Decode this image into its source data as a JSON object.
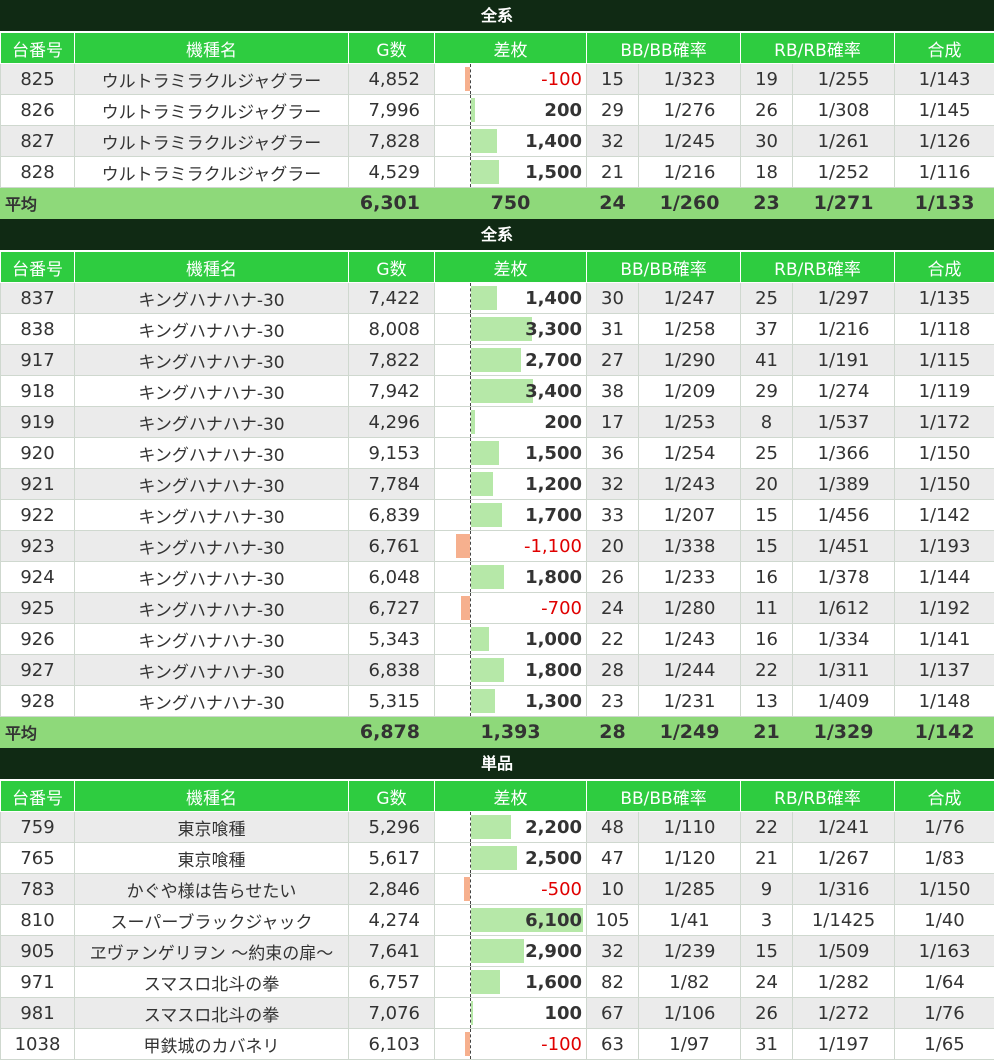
{
  "headers": {
    "no": "台番号",
    "name": "機種名",
    "g": "G数",
    "diff": "差枚",
    "bb": "BB/BB確率",
    "rb": "RB/RB確率",
    "total": "合成"
  },
  "colors": {
    "title_bg": "#102a14",
    "header_bg": "#2ecc40",
    "avg_bg": "#8ed97a",
    "pos_bar": "#b6e8a8",
    "neg_bar": "#f6b08e",
    "neg_text": "#e00000"
  },
  "sections": [
    {
      "title": "全系",
      "rows": [
        {
          "no": "825",
          "name": "ウルトラミラクルジャグラー",
          "g": "4,852",
          "diff": "-100",
          "diff_value": -100,
          "bb": "15",
          "bb_prob": "1/323",
          "rb": "19",
          "rb_prob": "1/255",
          "total": "1/143"
        },
        {
          "no": "826",
          "name": "ウルトラミラクルジャグラー",
          "g": "7,996",
          "diff": "200",
          "diff_value": 200,
          "bb": "29",
          "bb_prob": "1/276",
          "rb": "26",
          "rb_prob": "1/308",
          "total": "1/145"
        },
        {
          "no": "827",
          "name": "ウルトラミラクルジャグラー",
          "g": "7,828",
          "diff": "1,400",
          "diff_value": 1400,
          "bb": "32",
          "bb_prob": "1/245",
          "rb": "30",
          "rb_prob": "1/261",
          "total": "1/126"
        },
        {
          "no": "828",
          "name": "ウルトラミラクルジャグラー",
          "g": "4,529",
          "diff": "1,500",
          "diff_value": 1500,
          "bb": "21",
          "bb_prob": "1/216",
          "rb": "18",
          "rb_prob": "1/252",
          "total": "1/116"
        }
      ],
      "avg": {
        "label": "平均",
        "g": "6,301",
        "diff": "750",
        "bb": "24",
        "bb_prob": "1/260",
        "rb": "23",
        "rb_prob": "1/271",
        "total": "1/133"
      }
    },
    {
      "title": "全系",
      "rows": [
        {
          "no": "837",
          "name": "キングハナハナ-30",
          "g": "7,422",
          "diff": "1,400",
          "diff_value": 1400,
          "bb": "30",
          "bb_prob": "1/247",
          "rb": "25",
          "rb_prob": "1/297",
          "total": "1/135"
        },
        {
          "no": "838",
          "name": "キングハナハナ-30",
          "g": "8,008",
          "diff": "3,300",
          "diff_value": 3300,
          "bb": "31",
          "bb_prob": "1/258",
          "rb": "37",
          "rb_prob": "1/216",
          "total": "1/118"
        },
        {
          "no": "917",
          "name": "キングハナハナ-30",
          "g": "7,822",
          "diff": "2,700",
          "diff_value": 2700,
          "bb": "27",
          "bb_prob": "1/290",
          "rb": "41",
          "rb_prob": "1/191",
          "total": "1/115"
        },
        {
          "no": "918",
          "name": "キングハナハナ-30",
          "g": "7,942",
          "diff": "3,400",
          "diff_value": 3400,
          "bb": "38",
          "bb_prob": "1/209",
          "rb": "29",
          "rb_prob": "1/274",
          "total": "1/119"
        },
        {
          "no": "919",
          "name": "キングハナハナ-30",
          "g": "4,296",
          "diff": "200",
          "diff_value": 200,
          "bb": "17",
          "bb_prob": "1/253",
          "rb": "8",
          "rb_prob": "1/537",
          "total": "1/172"
        },
        {
          "no": "920",
          "name": "キングハナハナ-30",
          "g": "9,153",
          "diff": "1,500",
          "diff_value": 1500,
          "bb": "36",
          "bb_prob": "1/254",
          "rb": "25",
          "rb_prob": "1/366",
          "total": "1/150"
        },
        {
          "no": "921",
          "name": "キングハナハナ-30",
          "g": "7,784",
          "diff": "1,200",
          "diff_value": 1200,
          "bb": "32",
          "bb_prob": "1/243",
          "rb": "20",
          "rb_prob": "1/389",
          "total": "1/150"
        },
        {
          "no": "922",
          "name": "キングハナハナ-30",
          "g": "6,839",
          "diff": "1,700",
          "diff_value": 1700,
          "bb": "33",
          "bb_prob": "1/207",
          "rb": "15",
          "rb_prob": "1/456",
          "total": "1/142"
        },
        {
          "no": "923",
          "name": "キングハナハナ-30",
          "g": "6,761",
          "diff": "-1,100",
          "diff_value": -1100,
          "bb": "20",
          "bb_prob": "1/338",
          "rb": "15",
          "rb_prob": "1/451",
          "total": "1/193"
        },
        {
          "no": "924",
          "name": "キングハナハナ-30",
          "g": "6,048",
          "diff": "1,800",
          "diff_value": 1800,
          "bb": "26",
          "bb_prob": "1/233",
          "rb": "16",
          "rb_prob": "1/378",
          "total": "1/144"
        },
        {
          "no": "925",
          "name": "キングハナハナ-30",
          "g": "6,727",
          "diff": "-700",
          "diff_value": -700,
          "bb": "24",
          "bb_prob": "1/280",
          "rb": "11",
          "rb_prob": "1/612",
          "total": "1/192"
        },
        {
          "no": "926",
          "name": "キングハナハナ-30",
          "g": "5,343",
          "diff": "1,000",
          "diff_value": 1000,
          "bb": "22",
          "bb_prob": "1/243",
          "rb": "16",
          "rb_prob": "1/334",
          "total": "1/141"
        },
        {
          "no": "927",
          "name": "キングハナハナ-30",
          "g": "6,838",
          "diff": "1,800",
          "diff_value": 1800,
          "bb": "28",
          "bb_prob": "1/244",
          "rb": "22",
          "rb_prob": "1/311",
          "total": "1/137"
        },
        {
          "no": "928",
          "name": "キングハナハナ-30",
          "g": "5,315",
          "diff": "1,300",
          "diff_value": 1300,
          "bb": "23",
          "bb_prob": "1/231",
          "rb": "13",
          "rb_prob": "1/409",
          "total": "1/148"
        }
      ],
      "avg": {
        "label": "平均",
        "g": "6,878",
        "diff": "1,393",
        "bb": "28",
        "bb_prob": "1/249",
        "rb": "21",
        "rb_prob": "1/329",
        "total": "1/142"
      }
    },
    {
      "title": "単品",
      "rows": [
        {
          "no": "759",
          "name": "東京喰種",
          "g": "5,296",
          "diff": "2,200",
          "diff_value": 2200,
          "bb": "48",
          "bb_prob": "1/110",
          "rb": "22",
          "rb_prob": "1/241",
          "total": "1/76"
        },
        {
          "no": "765",
          "name": "東京喰種",
          "g": "5,617",
          "diff": "2,500",
          "diff_value": 2500,
          "bb": "47",
          "bb_prob": "1/120",
          "rb": "21",
          "rb_prob": "1/267",
          "total": "1/83"
        },
        {
          "no": "783",
          "name": "かぐや様は告らせたい",
          "g": "2,846",
          "diff": "-500",
          "diff_value": -500,
          "bb": "10",
          "bb_prob": "1/285",
          "rb": "9",
          "rb_prob": "1/316",
          "total": "1/150"
        },
        {
          "no": "810",
          "name": "スーパーブラックジャック",
          "g": "4,274",
          "diff": "6,100",
          "diff_value": 6100,
          "bb": "105",
          "bb_prob": "1/41",
          "rb": "3",
          "rb_prob": "1/1425",
          "total": "1/40"
        },
        {
          "no": "905",
          "name": "ヱヴァンゲリヲン ～約束の扉～",
          "g": "7,641",
          "diff": "2,900",
          "diff_value": 2900,
          "bb": "32",
          "bb_prob": "1/239",
          "rb": "15",
          "rb_prob": "1/509",
          "total": "1/163"
        },
        {
          "no": "971",
          "name": "スマスロ北斗の拳",
          "g": "6,757",
          "diff": "1,600",
          "diff_value": 1600,
          "bb": "82",
          "bb_prob": "1/82",
          "rb": "24",
          "rb_prob": "1/282",
          "total": "1/64"
        },
        {
          "no": "981",
          "name": "スマスロ北斗の拳",
          "g": "7,076",
          "diff": "100",
          "diff_value": 100,
          "bb": "67",
          "bb_prob": "1/106",
          "rb": "26",
          "rb_prob": "1/272",
          "total": "1/76"
        },
        {
          "no": "1038",
          "name": "甲鉄城のカバネリ",
          "g": "6,103",
          "diff": "-100",
          "diff_value": -100,
          "bb": "63",
          "bb_prob": "1/97",
          "rb": "31",
          "rb_prob": "1/197",
          "total": "1/65"
        }
      ]
    }
  ]
}
